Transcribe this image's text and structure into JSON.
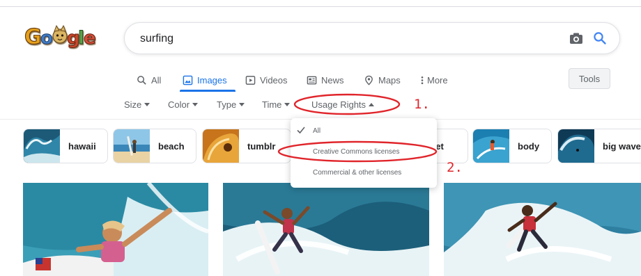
{
  "search": {
    "query": "surfing"
  },
  "tabs": [
    {
      "label": "All",
      "icon": "search-icon"
    },
    {
      "label": "Images",
      "icon": "image-icon"
    },
    {
      "label": "Videos",
      "icon": "video-icon"
    },
    {
      "label": "News",
      "icon": "news-icon"
    },
    {
      "label": "Maps",
      "icon": "map-pin-icon"
    },
    {
      "label": "More",
      "icon": "more-vertical-icon"
    }
  ],
  "tools_label": "Tools",
  "filters": [
    {
      "label": "Size"
    },
    {
      "label": "Color"
    },
    {
      "label": "Type"
    },
    {
      "label": "Time"
    },
    {
      "label": "Usage Rights"
    }
  ],
  "chips": [
    {
      "label": "hawaii"
    },
    {
      "label": "beach"
    },
    {
      "label": "tumblr"
    },
    {
      "label": "set"
    },
    {
      "label": "body"
    },
    {
      "label": "big wave"
    }
  ],
  "usage_menu": {
    "items": [
      {
        "label": "All",
        "checked": true
      },
      {
        "label": "Creative Commons licenses",
        "checked": false
      },
      {
        "label": "Commercial & other licenses",
        "checked": false
      }
    ]
  },
  "annotations": {
    "step1": "1.",
    "step2": "2."
  },
  "colors": {
    "accent": "#1a73e8",
    "annotation": "#e0252b"
  }
}
